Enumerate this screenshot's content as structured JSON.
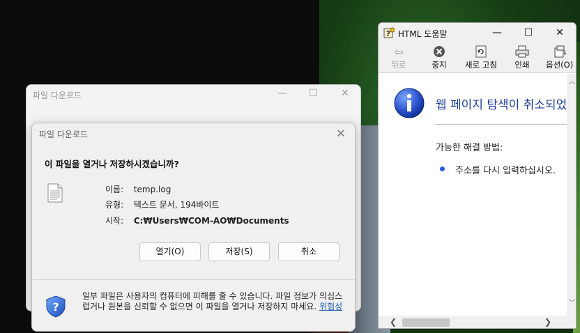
{
  "back_window": {
    "title": "파일 다운로드"
  },
  "dialog": {
    "title": "파일 다운로드",
    "question": "이 파일을 열거나 저장하시겠습니까?",
    "name_label": "이름:",
    "name_value": "temp.log",
    "type_label": "유형:",
    "type_value": "텍스트 문서, 194바이트",
    "from_label": "시작:",
    "from_value": "C:₩Users₩COM-AO₩Documents",
    "open_button": "열기(O)",
    "save_button": "저장(S)",
    "cancel_button": "취소",
    "warning_text": "일부 파일은 사용자의 컴퓨터에 피해를 줄 수 있습니다. 파일 정보가 의심스럽거나 원본을 신뢰할 수 없으면 이 파일을 열거나 저장하지 마세요.",
    "risk_link": "위험성"
  },
  "help_window": {
    "title": "HTML 도움말",
    "toolbar": {
      "back": "뒤로",
      "stop": "중지",
      "refresh": "새로 고침",
      "print": "인쇄",
      "options": "옵션(O)"
    },
    "content": {
      "heading": "웹 페이지 탐색이 취소되었습니다",
      "subheading": "가능한 해결 방법:",
      "bullet": "주소를 다시 입력하십시오."
    }
  },
  "colors": {
    "link": "#1a5fb4",
    "heading": "#1c3f9a",
    "bullet": "#2a5bd7"
  },
  "icons": [
    "document-icon",
    "shield-icon",
    "help-icon",
    "info-icon",
    "back-arrow-icon",
    "stop-icon",
    "refresh-icon",
    "print-icon",
    "options-icon"
  ]
}
